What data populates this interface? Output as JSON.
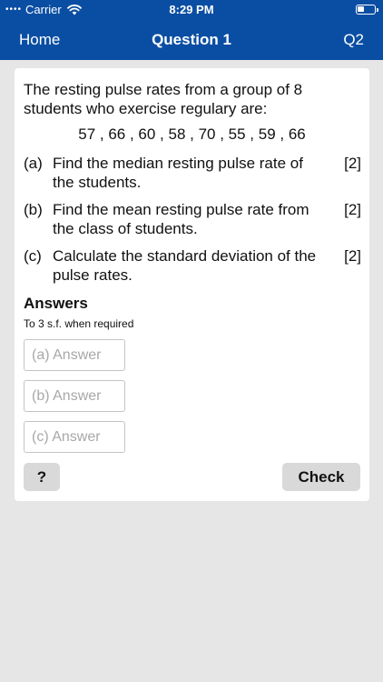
{
  "status_bar": {
    "carrier": "Carrier",
    "time": "8:29 PM"
  },
  "nav": {
    "home_label": "Home",
    "title": "Question 1",
    "next_label": "Q2"
  },
  "question": {
    "intro": "The resting pulse rates from a group of 8 students who exercise regulary are:",
    "data": "57 , 66 , 60 , 58 , 70 , 55 , 59 , 66",
    "parts": [
      {
        "letter": "(a)",
        "text": "Find the median resting pulse rate of the students.",
        "marks": "[2]"
      },
      {
        "letter": "(b)",
        "text": "Find the mean resting pulse rate from the class of students.",
        "marks": "[2]"
      },
      {
        "letter": "(c)",
        "text": "Calculate the standard deviation of the pulse rates.",
        "marks": "[2]"
      }
    ]
  },
  "answers": {
    "title": "Answers",
    "note": "To 3 s.f. when required",
    "inputs": [
      {
        "placeholder": "(a) Answer",
        "value": ""
      },
      {
        "placeholder": "(b) Answer",
        "value": ""
      },
      {
        "placeholder": "(c) Answer",
        "value": ""
      }
    ]
  },
  "buttons": {
    "help_label": "?",
    "check_label": "Check"
  },
  "colors": {
    "header": "#0a4ea3",
    "background": "#e6e6e6",
    "button": "#d9d9d9"
  }
}
